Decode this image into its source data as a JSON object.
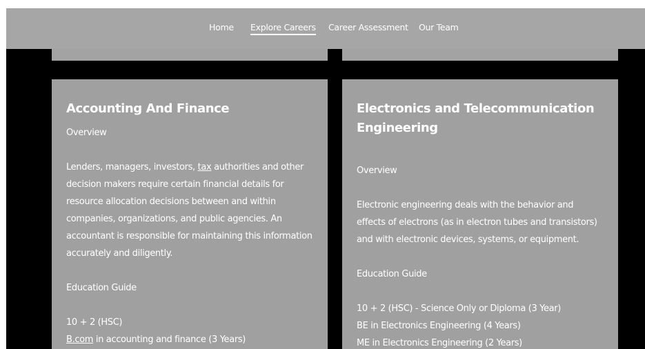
{
  "nav": {
    "items": [
      {
        "label": "Home"
      },
      {
        "label": "Explore Careers"
      },
      {
        "label": "Career Assessment"
      },
      {
        "label": "Our Team"
      }
    ],
    "active": "Explore Careers"
  },
  "cards": [
    {
      "title": "Accounting And Finance",
      "overview_label": "Overview",
      "description": {
        "before_link": "Lenders, managers, investors, ",
        "link": "tax",
        "after_link": " authorities and other decision makers require certain financial details for resource allocation decisions between and within companies, organizations, and public agencies.  An accountant is responsible for maintaining this information accurately and diligently."
      },
      "education_label": "Education Guide",
      "education": [
        {
          "text": "10 + 2 (HSC)"
        },
        {
          "link": "B.com",
          "text": " in accounting and finance (3 Years)"
        }
      ]
    },
    {
      "title": "Electronics and Telecommunication Engineering",
      "overview_label": "Overview",
      "description": "Electronic engineering deals with the behavior and effects of electrons (as in electron tubes and transistors) and with electronic devices, systems, or equipment.",
      "education_label": "Education Guide",
      "education": [
        "10 + 2 (HSC) - Science Only or Diploma (3 Year)",
        "BE in Electronics Engineering (4 Years)",
        "ME in Electronics Engineering (2 Years)"
      ]
    }
  ],
  "colors": {
    "navbar": "#a6a6a6",
    "card": "#a0a0a0",
    "background": "#000000",
    "text": "#ffffff"
  }
}
